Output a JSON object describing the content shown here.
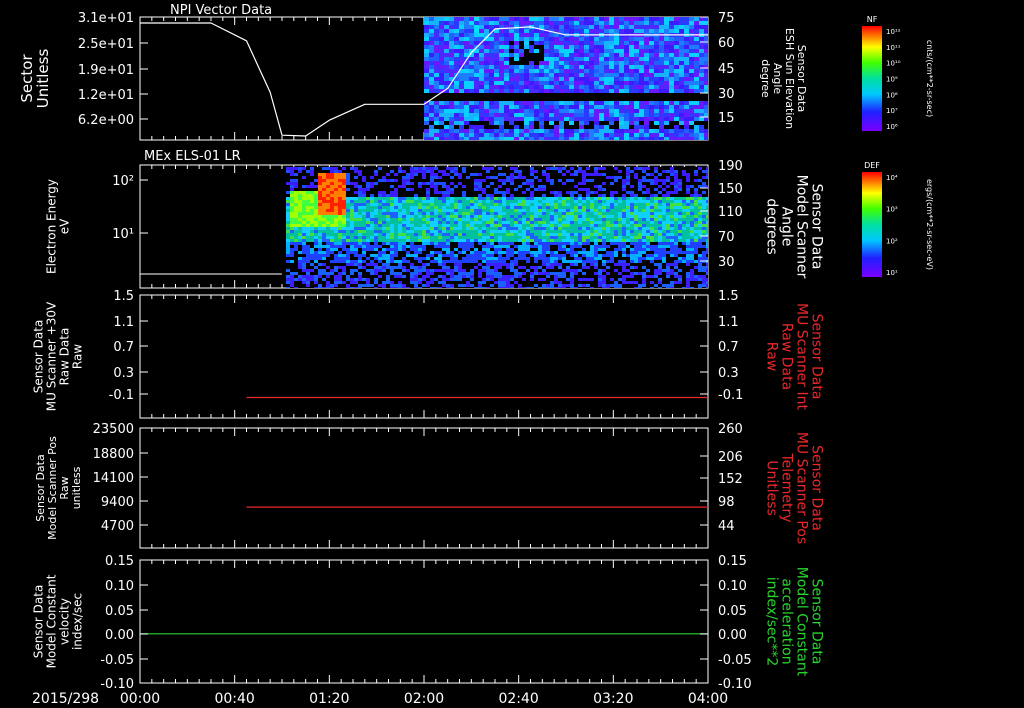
{
  "date_label": "2015/298",
  "time_ticks": [
    "00:00",
    "00:40",
    "01:20",
    "02:00",
    "02:40",
    "03:20",
    "04:00"
  ],
  "colors": {
    "white": "#ffffff",
    "red": "#e8282b",
    "green": "#28d42f",
    "frame": "#ffffff"
  },
  "panels": [
    {
      "title": "NPI Vector Data",
      "left_label": [
        "Sector",
        "Unitless"
      ],
      "right_label": [
        "Sensor Data",
        "ESH Sun Elevation",
        "Angle",
        "degree"
      ],
      "left_ticks": [
        "3.1e+01",
        "2.5e+01",
        "1.9e+01",
        "1.2e+01",
        "6.2e+00"
      ],
      "right_ticks": [
        "75",
        "60",
        "45",
        "30",
        "15"
      ],
      "right_label_color": "#ffffff"
    },
    {
      "title": "MEx ELS-01 LR",
      "left_label": [
        "Electron Energy",
        "eV"
      ],
      "right_label": [
        "Sensor Data",
        "Model Scanner",
        "Angle",
        "degrees"
      ],
      "left_ticks": [
        "10²",
        "10¹"
      ],
      "right_ticks": [
        "190",
        "150",
        "110",
        "70",
        "30"
      ],
      "right_label_color": "#ffffff"
    },
    {
      "title": "",
      "left_label": [
        "Sensor Data",
        "MU Scanner +30V",
        "Raw Data",
        "Raw"
      ],
      "right_label": [
        "Sensor Data",
        "MU Scanner Int",
        "Raw Data",
        "Raw"
      ],
      "left_ticks": [
        "1.5",
        "1.1",
        "0.7",
        "0.3",
        "-0.1"
      ],
      "right_ticks": [
        "1.5",
        "1.1",
        "0.7",
        "0.3",
        "-0.1"
      ],
      "right_label_color": "#e8282b"
    },
    {
      "title": "",
      "left_label": [
        "Sensor Data",
        "Model Scanner Pos",
        "Raw",
        "unitless"
      ],
      "right_label": [
        "Sensor Data",
        "MU Scanner Pos",
        "Telemetry",
        "Unitless"
      ],
      "left_ticks": [
        "23500",
        "18800",
        "14100",
        "9400",
        "4700"
      ],
      "right_ticks": [
        "260",
        "206",
        "152",
        "98",
        "44"
      ],
      "right_label_color": "#e8282b"
    },
    {
      "title": "",
      "left_label": [
        "Sensor Data",
        "Model Constant",
        "velocity",
        "index/sec"
      ],
      "right_label": [
        "Sensor Data",
        "Model Constant",
        "acceleration",
        "index/sec**2"
      ],
      "left_ticks": [
        "0.15",
        "0.10",
        "0.05",
        "0.00",
        "-0.05",
        "-0.10"
      ],
      "right_ticks": [
        "0.15",
        "0.10",
        "0.05",
        "0.00",
        "-0.05",
        "-0.10"
      ],
      "right_label_color": "#28d42f"
    }
  ],
  "colorbars": [
    {
      "label": "NF",
      "units": "cnts/(cm**2-sr-sec)",
      "ticks": [
        "10¹²",
        "10¹¹",
        "10¹⁰",
        "10⁹",
        "10⁸",
        "10⁷",
        "10⁶"
      ]
    },
    {
      "label": "DEF",
      "units": "ergs/(cm**2-sr-sec-eV)",
      "ticks": [
        "10⁴",
        "10³",
        "10²",
        "10¹"
      ]
    }
  ],
  "chart_data": [
    {
      "type": "line",
      "title": "NPI Vector Data",
      "xlabel": "",
      "x_range": [
        "00:00",
        "04:00"
      ],
      "ylabel_left": "Sector Unitless",
      "ylim_left": [
        0,
        31
      ],
      "ylabel_right": "Sensor Data ESH Sun Elevation Angle degree",
      "ylim_right": [
        0,
        80
      ],
      "series": [
        {
          "x": [
            "00:00",
            "00:30",
            "00:45",
            "00:55",
            "01:00",
            "01:10",
            "01:20",
            "01:35",
            "02:00",
            "02:10",
            "02:20",
            "02:30",
            "02:45",
            "03:00",
            "03:20",
            "04:00"
          ],
          "y": [
            29.5,
            29.5,
            25,
            12,
            1.2,
            1.0,
            5,
            9,
            9,
            13,
            22,
            28,
            28.5,
            26.5,
            26.5,
            26.5
          ]
        }
      ],
      "spectrogram_start": "02:00",
      "spectrogram_colorbar": "NF"
    },
    {
      "type": "heatmap",
      "title": "MEx ELS-01 LR",
      "ylabel_left": "Electron Energy eV",
      "ylabel_right": "Sensor Data Model Scanner Angle degrees",
      "x_range": [
        "00:00",
        "04:00"
      ],
      "y_scale": "log",
      "series": [
        {
          "x": [
            "00:00",
            "01:00"
          ],
          "y": [
            2,
            2
          ]
        }
      ],
      "data_start": "01:00",
      "colorbar": "DEF"
    },
    {
      "type": "line",
      "ylabel_left": "Sensor Data MU Scanner +30V Raw Data Raw",
      "ylim": [
        -0.3,
        1.5
      ],
      "series": [
        {
          "x": [
            "00:45",
            "04:00"
          ],
          "y": [
            0.0,
            0.0
          ],
          "color": "#e8282b"
        }
      ]
    },
    {
      "type": "line",
      "ylabel_left": "Sensor Data Model Scanner Pos Raw unitless",
      "ylim": [
        0,
        23500
      ],
      "series": [
        {
          "x": [
            "00:45",
            "04:00"
          ],
          "y": [
            8000,
            8000
          ],
          "color": "#e8282b"
        }
      ]
    },
    {
      "type": "line",
      "ylabel_left": "Sensor Data Model Constant velocity index/sec",
      "ylim": [
        -0.1,
        0.15
      ],
      "series": [
        {
          "x": [
            "00:00",
            "04:00"
          ],
          "y": [
            0.0,
            0.0
          ],
          "color": "#28d42f"
        }
      ]
    }
  ]
}
